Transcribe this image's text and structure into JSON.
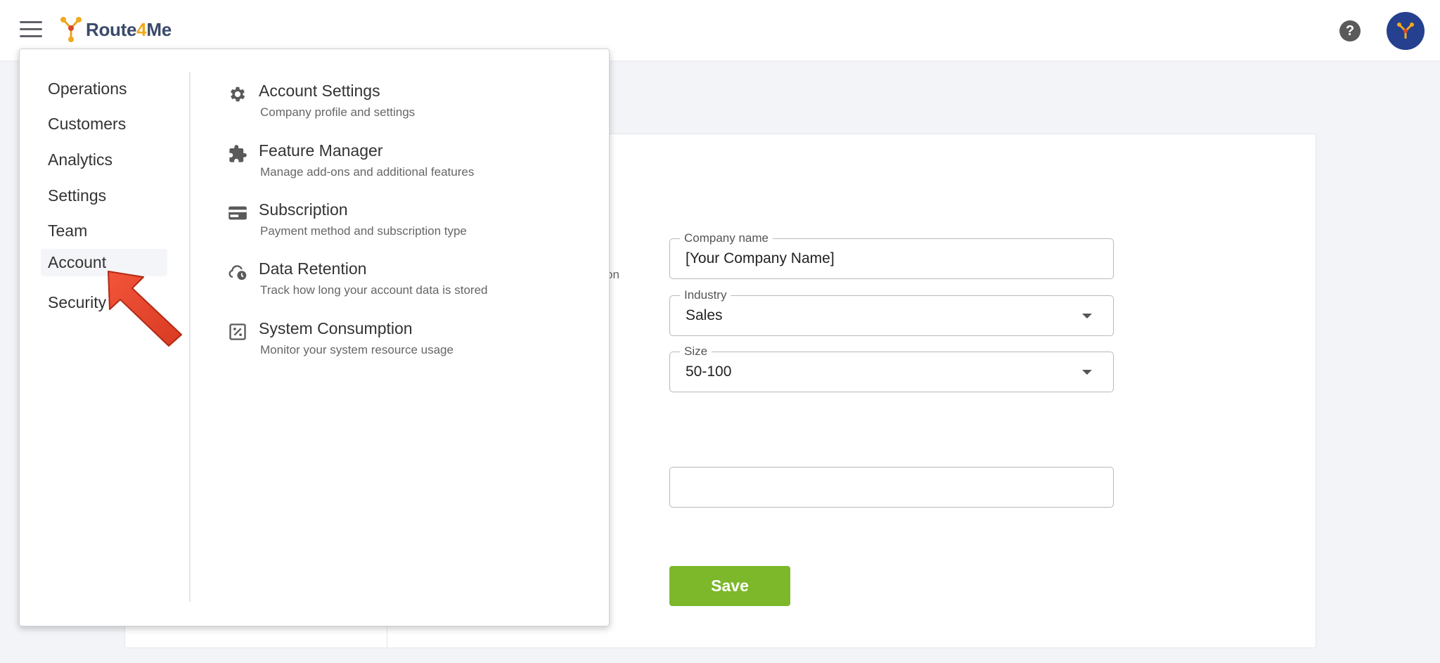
{
  "header": {
    "logo_text_1": "Route",
    "logo_text_2": "4",
    "logo_text_3": "Me",
    "help_icon": "?"
  },
  "menu": {
    "nav": [
      {
        "label": "Operations"
      },
      {
        "label": "Customers"
      },
      {
        "label": "Analytics"
      },
      {
        "label": "Settings"
      },
      {
        "label": "Team"
      },
      {
        "label": "Account"
      },
      {
        "label": "Security"
      }
    ],
    "active_nav": "Account",
    "sub_items": [
      {
        "title": "Account Settings",
        "desc": "Company profile and settings",
        "icon": "gear-icon"
      },
      {
        "title": "Feature Manager",
        "desc": "Manage add-ons and additional features",
        "icon": "puzzle-icon"
      },
      {
        "title": "Subscription",
        "desc": "Payment method and subscription type",
        "icon": "credit-card-icon"
      },
      {
        "title": "Data Retention",
        "desc": "Track how long your account data is stored",
        "icon": "cloud-clock-icon"
      },
      {
        "title": "System Consumption",
        "desc": "Monitor your system resource usage",
        "icon": "percent-box-icon"
      }
    ]
  },
  "form": {
    "partial_text": "on",
    "company_name": {
      "label": "Company name",
      "value": "[Your Company Name]"
    },
    "industry": {
      "label": "Industry",
      "value": "Sales"
    },
    "size": {
      "label": "Size",
      "value": "50-100"
    },
    "extra_field_value": "",
    "save_label": "Save"
  },
  "colors": {
    "accent_green": "#7cb82a",
    "logo_orange": "#f2a81d",
    "avatar_blue": "#24408e",
    "annotation_red": "#e8412d"
  }
}
